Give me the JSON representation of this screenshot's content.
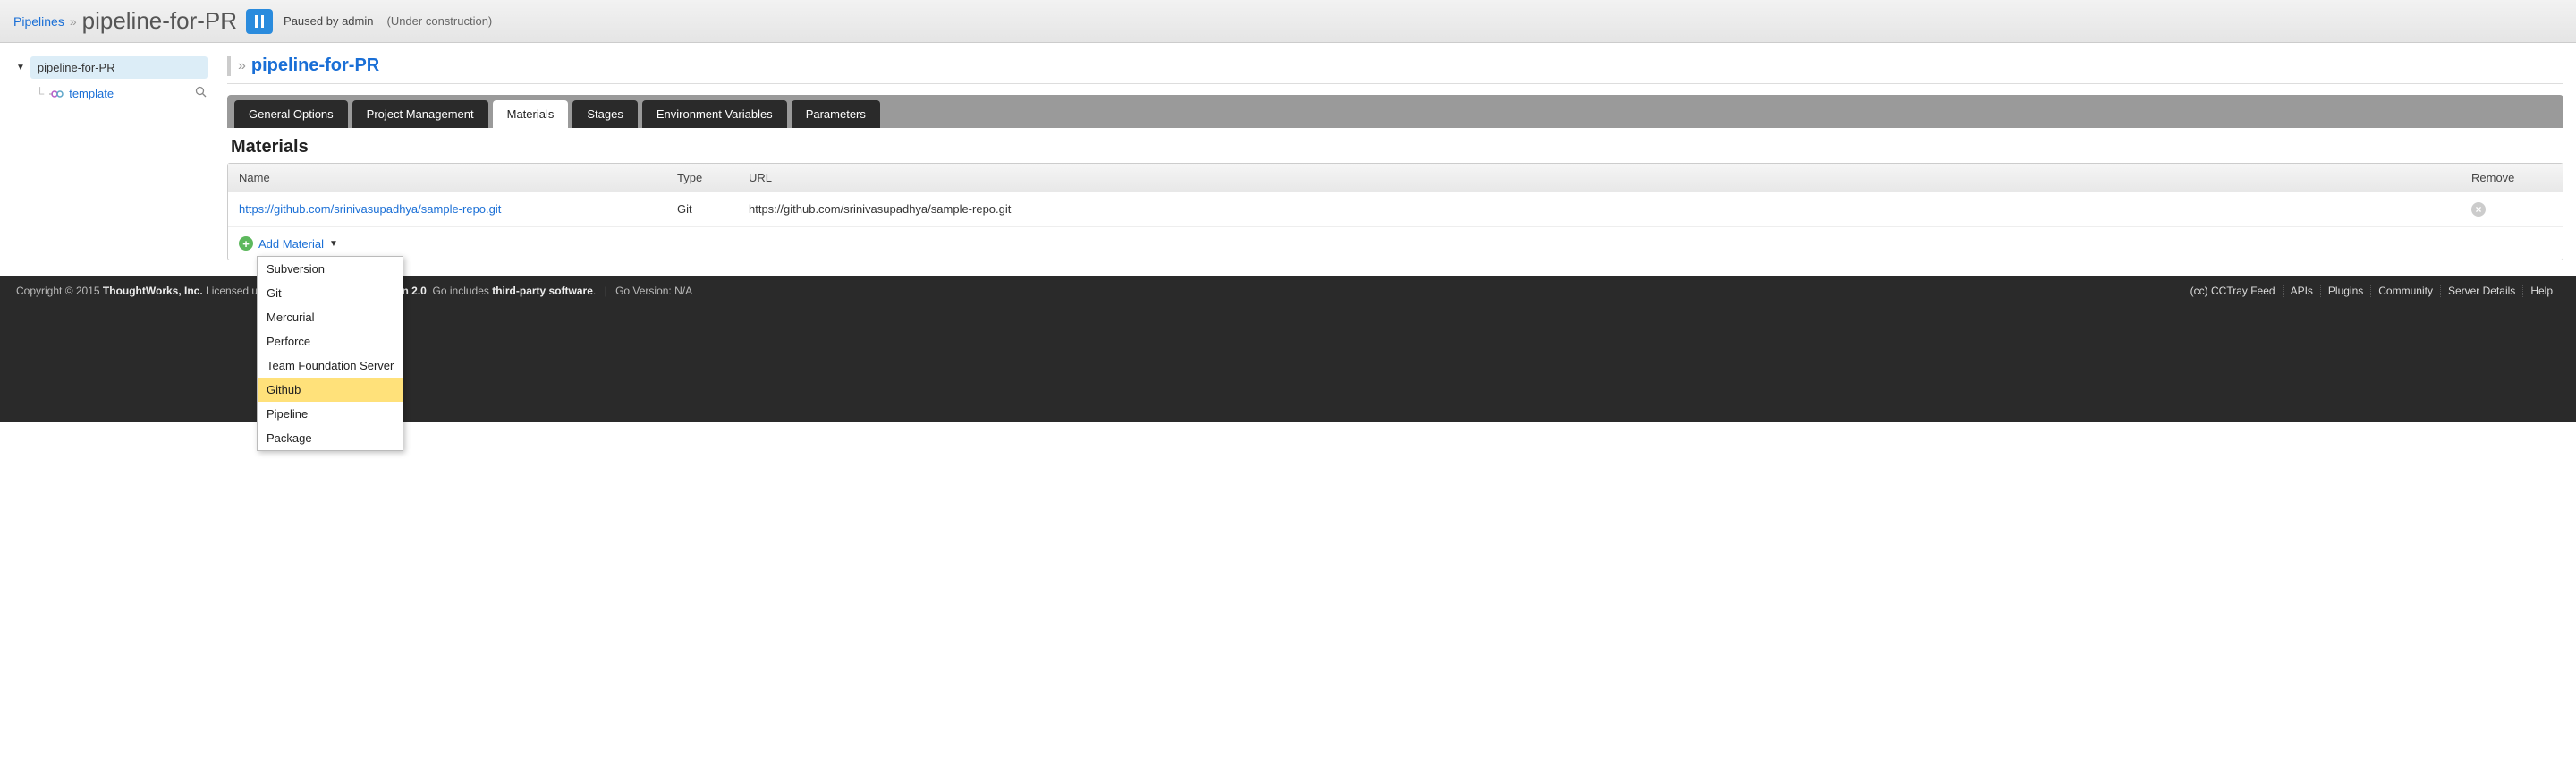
{
  "header": {
    "breadcrumb_root": "Pipelines",
    "pipeline_name": "pipeline-for-PR",
    "paused_by": "Paused by admin",
    "status_note": "(Under construction)"
  },
  "sidebar": {
    "pipeline_name": "pipeline-for-PR",
    "template_label": "template"
  },
  "main": {
    "header_title": "pipeline-for-PR",
    "tabs": [
      {
        "label": "General Options",
        "active": false
      },
      {
        "label": "Project Management",
        "active": false
      },
      {
        "label": "Materials",
        "active": true
      },
      {
        "label": "Stages",
        "active": false
      },
      {
        "label": "Environment Variables",
        "active": false
      },
      {
        "label": "Parameters",
        "active": false
      }
    ],
    "section_title": "Materials",
    "table": {
      "headers": {
        "name": "Name",
        "type": "Type",
        "url": "URL",
        "remove": "Remove"
      },
      "rows": [
        {
          "name": "https://github.com/srinivasupadhya/sample-repo.git",
          "type": "Git",
          "url": "https://github.com/srinivasupadhya/sample-repo.git"
        }
      ]
    },
    "add_material_label": "Add Material",
    "dropdown": {
      "items": [
        {
          "label": "Subversion",
          "highlighted": false
        },
        {
          "label": "Git",
          "highlighted": false
        },
        {
          "label": "Mercurial",
          "highlighted": false
        },
        {
          "label": "Perforce",
          "highlighted": false
        },
        {
          "label": "Team Foundation Server",
          "highlighted": false
        },
        {
          "label": "Github",
          "highlighted": true
        },
        {
          "label": "Pipeline",
          "highlighted": false
        },
        {
          "label": "Package",
          "highlighted": false
        }
      ]
    }
  },
  "footer": {
    "copyright_prefix": "Copyright © 2015 ",
    "company": "ThoughtWorks, Inc.",
    "licensed_prefix": " Licensed under ",
    "license": "Apache License, Version 2.0",
    "go_includes_prefix": ". Go includes ",
    "third_party": "third-party software",
    "go_version": "Go Version: N/A",
    "links": [
      "(cc) CCTray Feed",
      "APIs",
      "Plugins",
      "Community",
      "Server Details",
      "Help"
    ]
  }
}
